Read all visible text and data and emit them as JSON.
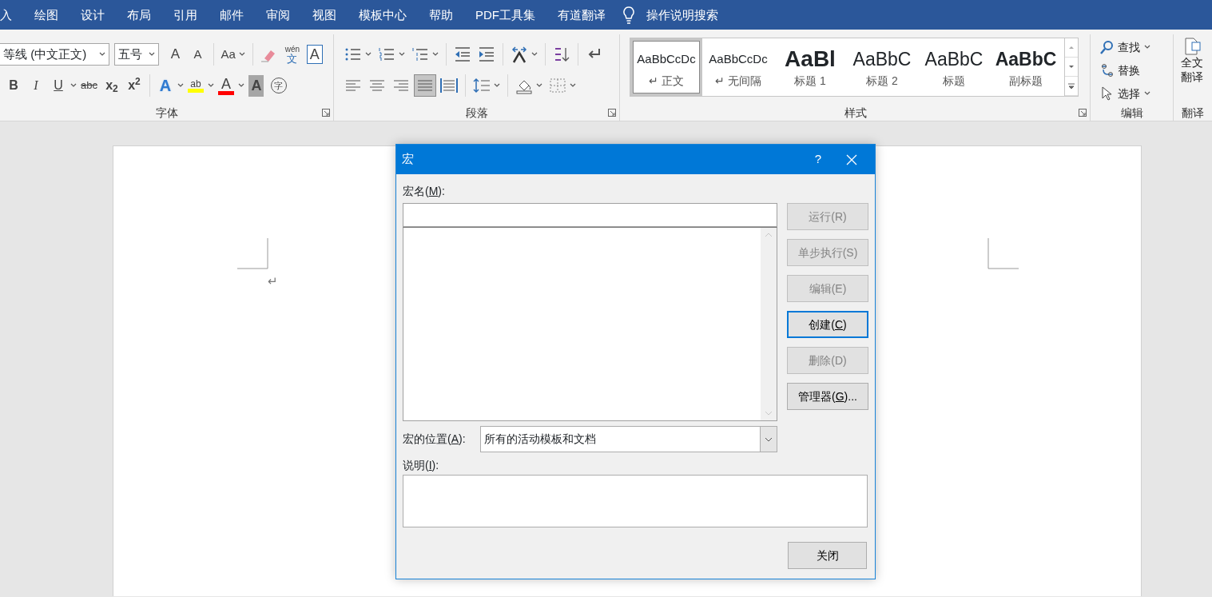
{
  "menu_tabs": [
    {
      "label": "入"
    },
    {
      "label": "绘图"
    },
    {
      "label": "设计"
    },
    {
      "label": "布局"
    },
    {
      "label": "引用"
    },
    {
      "label": "邮件"
    },
    {
      "label": "审阅"
    },
    {
      "label": "视图"
    },
    {
      "label": "模板中心"
    },
    {
      "label": "帮助"
    },
    {
      "label": "PDF工具集"
    },
    {
      "label": "有道翻译"
    }
  ],
  "tell_me": {
    "placeholder": "操作说明搜索"
  },
  "font_group": {
    "label": "字体",
    "font_name": "等线 (中文正文)",
    "font_size": "五号",
    "glyphs": [
      {
        "label": "A"
      },
      {
        "label": "A"
      },
      {
        "label": "Aa"
      },
      {
        "label": "wén"
      },
      {
        "label": "文"
      },
      {
        "label": "A"
      },
      {
        "label": "B"
      },
      {
        "label": "I"
      },
      {
        "label": "U"
      },
      {
        "label": "abc"
      },
      {
        "label": "x$_{2}$"
      },
      {
        "label": "x$^{2}$"
      },
      {
        "label": "A"
      },
      {
        "label": "ab"
      },
      {
        "label": "A"
      },
      {
        "label": "A"
      },
      {
        "label": "字"
      }
    ],
    "highlight": {
      "color": "#ffff00"
    },
    "font_color": {
      "color": "#ff0000"
    }
  },
  "paragraph_group": {
    "label": "段落",
    "alignments": [
      {
        "selected": false
      },
      {
        "selected": false
      },
      {
        "selected": false
      },
      {
        "selected": true
      },
      {
        "selected": false
      }
    ]
  },
  "styles_group": {
    "label": "样式",
    "styles": [
      {
        "kind": "normal",
        "preview": "AaBbCcDc",
        "name": "↵ 正文",
        "selected": true
      },
      {
        "kind": "nospacing",
        "preview": "AaBbCcDc",
        "name": "↵ 无间隔",
        "selected": false
      },
      {
        "kind": "heading1",
        "preview": "AaBl",
        "name": "标题 1",
        "selected": false
      },
      {
        "kind": "heading2",
        "preview": "AaBbC",
        "name": "标题 2",
        "selected": false
      },
      {
        "kind": "title",
        "preview": "AaBbC",
        "name": "标题",
        "selected": false
      },
      {
        "kind": "subtitle",
        "preview": "AaBbC",
        "name": "副标题",
        "selected": false
      }
    ]
  },
  "editing_group": {
    "label": "编辑",
    "commands": [
      {
        "label": "查找"
      },
      {
        "label": "替换"
      },
      {
        "label": "选择"
      }
    ]
  },
  "translate_group": {
    "label": "翻译",
    "command": [
      "全文",
      "翻译"
    ]
  },
  "document": {
    "paragraph_mark": "↵"
  },
  "dialog": {
    "title": "宏",
    "help": "?",
    "name_label": {
      "before": "宏名(",
      "key": "M",
      "after": "):"
    },
    "buttons": [
      {
        "before": "运行(",
        "key": "R",
        "after": ")",
        "disabled": true,
        "default": false
      },
      {
        "before": "单步执行(",
        "key": "S",
        "after": ")",
        "disabled": true,
        "default": false
      },
      {
        "before": "编辑(",
        "key": "E",
        "after": ")",
        "disabled": true,
        "default": false
      },
      {
        "before": "创建(",
        "key": "C",
        "after": ")",
        "disabled": false,
        "default": true
      },
      {
        "before": "删除(",
        "key": "D",
        "after": ")",
        "disabled": true,
        "default": false
      },
      {
        "before": "管理器(",
        "key": "G",
        "after": ")...",
        "disabled": false,
        "default": false
      }
    ],
    "location_label": {
      "before": "宏的位置(",
      "key": "A",
      "after": "):"
    },
    "location_value": "所有的活动模板和文档",
    "description_label": {
      "before": "说明(",
      "key": "I",
      "after": "):"
    },
    "close_button": "关闭"
  }
}
